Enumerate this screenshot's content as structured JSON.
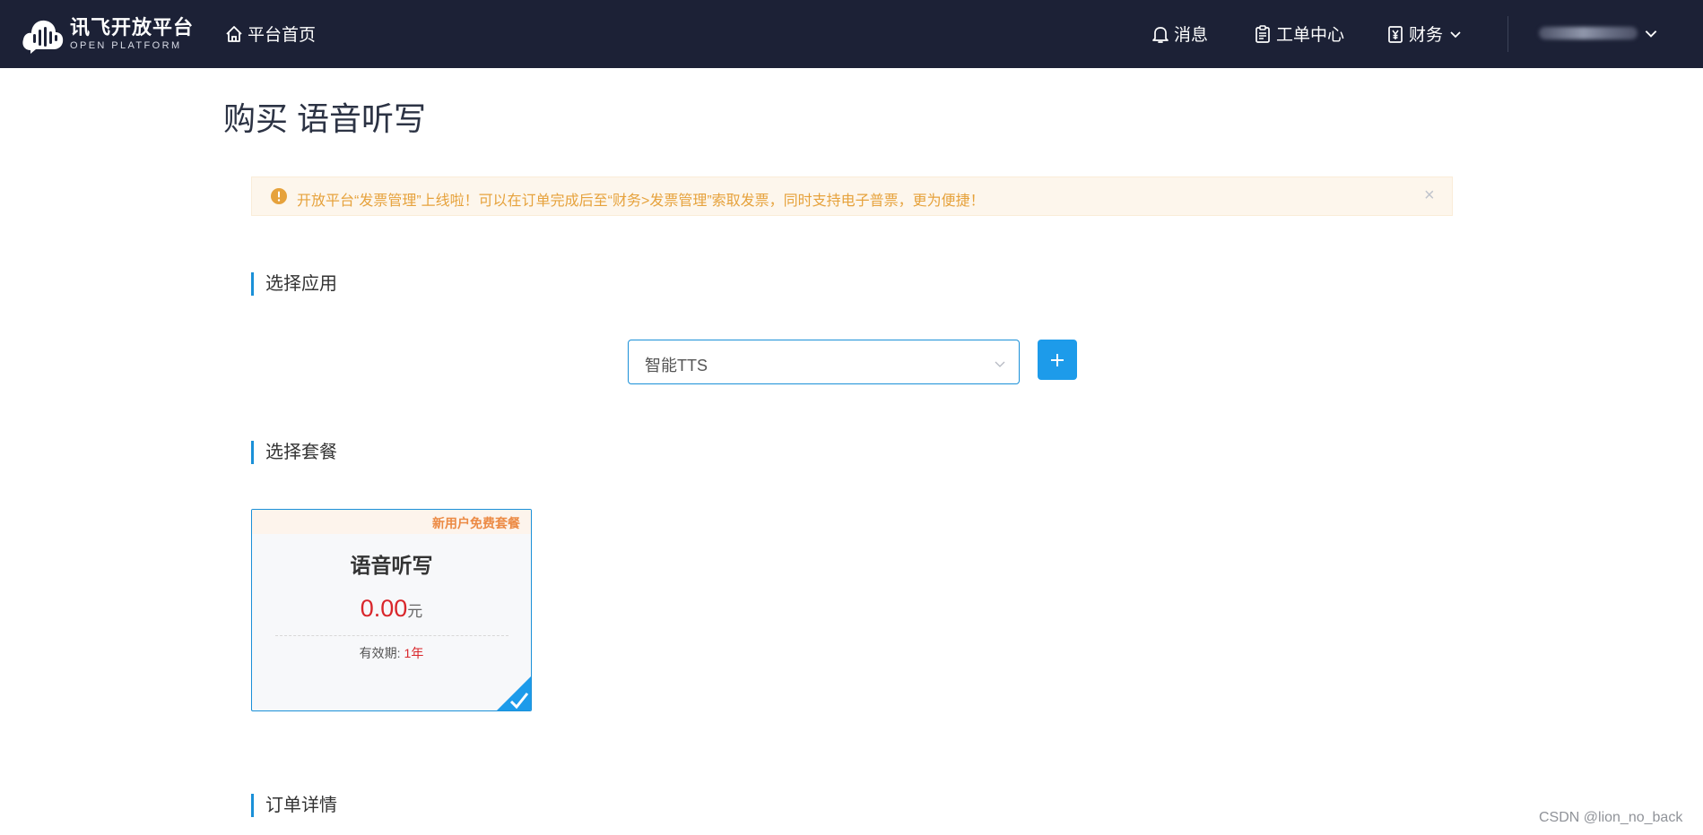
{
  "header": {
    "logo_cn": "讯飞开放平台",
    "logo_en": "OPEN PLATFORM",
    "home_label": "平台首页",
    "messages_label": "消息",
    "tickets_label": "工单中心",
    "finance_label": "财务",
    "bg_color": "#1c2136"
  },
  "page": {
    "title": "购买 语音听写"
  },
  "notice": {
    "text": "开放平台“发票管理”上线啦！可以在订单完成后至“财务>发票管理”索取发票，同时支持电子普票，更为便捷！",
    "close_label": "×",
    "color": "#e6a23c"
  },
  "select_app": {
    "title": "选择应用",
    "selected_value": "智能TTS",
    "add_label": "+",
    "accent": "#1d9bea"
  },
  "select_plan": {
    "title": "选择套餐",
    "card": {
      "badge": "新用户免费套餐",
      "name": "语音听写",
      "price": "0.00",
      "unit": "元",
      "validity_label": "有效期:",
      "validity_value": "1年",
      "selected": true
    }
  },
  "order_details": {
    "title": "订单详情"
  },
  "watermark": "CSDN @lion_no_back"
}
